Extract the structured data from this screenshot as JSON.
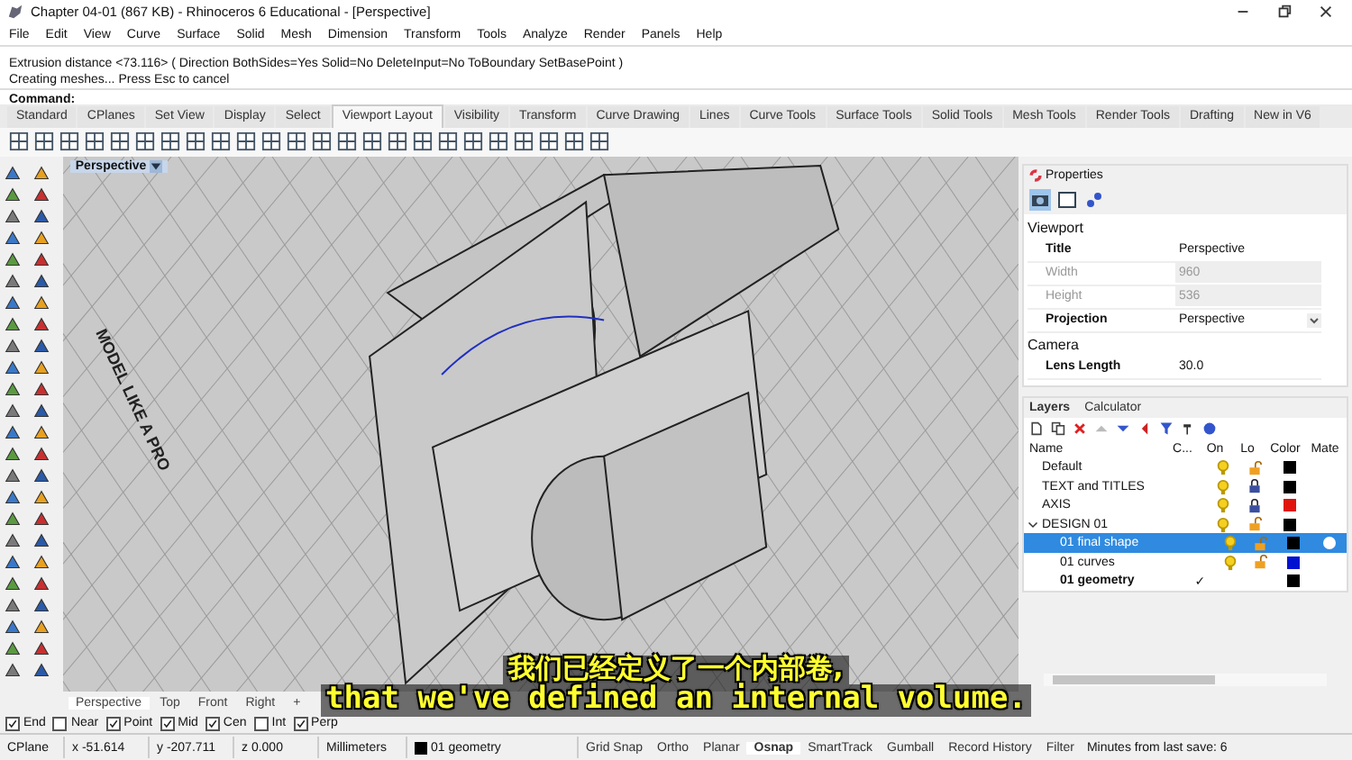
{
  "window": {
    "title": "Chapter 04-01 (867 KB) - Rhinoceros 6 Educational - [Perspective]"
  },
  "menu": [
    "File",
    "Edit",
    "View",
    "Curve",
    "Surface",
    "Solid",
    "Mesh",
    "Dimension",
    "Transform",
    "Tools",
    "Analyze",
    "Render",
    "Panels",
    "Help"
  ],
  "command_history": [
    "Extrusion distance <73.116> ( Direction  BothSides=Yes  Solid=No  DeleteInput=No  ToBoundary  SetBasePoint )",
    "Creating meshes... Press Esc to cancel"
  ],
  "command_prompt": "Command:",
  "toolbar_tabs": [
    {
      "label": "Standard",
      "selected": false
    },
    {
      "label": "CPlanes",
      "selected": false
    },
    {
      "label": "Set View",
      "selected": false
    },
    {
      "label": "Display",
      "selected": false
    },
    {
      "label": "Select",
      "selected": false
    },
    {
      "label": "Viewport Layout",
      "selected": true
    },
    {
      "label": "Visibility",
      "selected": false
    },
    {
      "label": "Transform",
      "selected": false
    },
    {
      "label": "Curve Drawing",
      "selected": false
    },
    {
      "label": "Lines",
      "selected": false
    },
    {
      "label": "Curve Tools",
      "selected": false
    },
    {
      "label": "Surface Tools",
      "selected": false
    },
    {
      "label": "Solid Tools",
      "selected": false
    },
    {
      "label": "Mesh Tools",
      "selected": false
    },
    {
      "label": "Render Tools",
      "selected": false
    },
    {
      "label": "Drafting",
      "selected": false
    },
    {
      "label": "New in V6",
      "selected": false
    }
  ],
  "viewport": {
    "title": "Perspective",
    "scene_text": "MODEL LIKE A PRO"
  },
  "viewport_tabs": [
    {
      "label": "Perspective",
      "selected": true
    },
    {
      "label": "Top",
      "selected": false
    },
    {
      "label": "Front",
      "selected": false
    },
    {
      "label": "Right",
      "selected": false
    },
    {
      "label": "+",
      "selected": false
    }
  ],
  "properties": {
    "title": "Properties",
    "rows": [
      {
        "kind": "section",
        "label": "Viewport"
      },
      {
        "kind": "field",
        "label": "Title",
        "value": "Perspective",
        "disabled": false
      },
      {
        "kind": "field",
        "label": "Width",
        "value": "960",
        "disabled": true
      },
      {
        "kind": "field",
        "label": "Height",
        "value": "536",
        "disabled": true
      },
      {
        "kind": "dropdown",
        "label": "Projection",
        "value": "Perspective",
        "disabled": false
      },
      {
        "kind": "section",
        "label": "Camera"
      },
      {
        "kind": "field",
        "label": "Lens Length",
        "value": "30.0",
        "disabled": false
      }
    ]
  },
  "layers": {
    "tabs": [
      {
        "label": "Layers",
        "selected": true
      },
      {
        "label": "Calculator",
        "selected": false
      }
    ],
    "columns": [
      "Name",
      "C...",
      "On",
      "Lo",
      "Color",
      "Mate"
    ],
    "items": [
      {
        "name": "Default",
        "on": true,
        "locked": false,
        "color": "#000000",
        "current": false,
        "selected": false
      },
      {
        "name": "TEXT and TITLES",
        "on": true,
        "locked": true,
        "color": "#000000",
        "current": false,
        "selected": false
      },
      {
        "name": "AXIS",
        "on": true,
        "locked": true,
        "color": "#e0140c",
        "current": false,
        "selected": false
      },
      {
        "name": "DESIGN 01",
        "on": true,
        "locked": false,
        "color": "#000000",
        "current": false,
        "selected": false,
        "expanded": true,
        "children": [
          {
            "name": "01 final shape",
            "on": true,
            "locked": false,
            "color": "#000000",
            "current": false,
            "selected": true
          },
          {
            "name": "01 curves",
            "on": true,
            "locked": false,
            "color": "#0012d0",
            "current": false,
            "selected": false
          },
          {
            "name": "01 geometry",
            "color": "#000000",
            "current": true,
            "selected": false,
            "check": "✓"
          }
        ]
      }
    ]
  },
  "osnaps": [
    {
      "label": "End",
      "checked": true
    },
    {
      "label": "Near",
      "checked": false
    },
    {
      "label": "Point",
      "checked": true
    },
    {
      "label": "Mid",
      "checked": true
    },
    {
      "label": "Cen",
      "checked": true
    },
    {
      "label": "Int",
      "checked": false
    },
    {
      "label": "Perp",
      "checked": true
    }
  ],
  "status_bar": {
    "cplane": "CPlane",
    "x": "x -51.614",
    "y": "y -207.711",
    "z": "z 0.000",
    "units": "Millimeters",
    "layer": "01 geometry",
    "toggles": [
      {
        "label": "Grid Snap",
        "on": false
      },
      {
        "label": "Ortho",
        "on": false
      },
      {
        "label": "Planar",
        "on": false
      },
      {
        "label": "Osnap",
        "on": true
      },
      {
        "label": "SmartTrack",
        "on": false
      },
      {
        "label": "Gumball",
        "on": false
      },
      {
        "label": "Record History",
        "on": false
      },
      {
        "label": "Filter",
        "on": false
      }
    ],
    "save_info": "Minutes from last save: 6"
  },
  "subtitles": [
    "我们已经定义了一个内部卷,",
    "that we've defined an internal volume."
  ]
}
